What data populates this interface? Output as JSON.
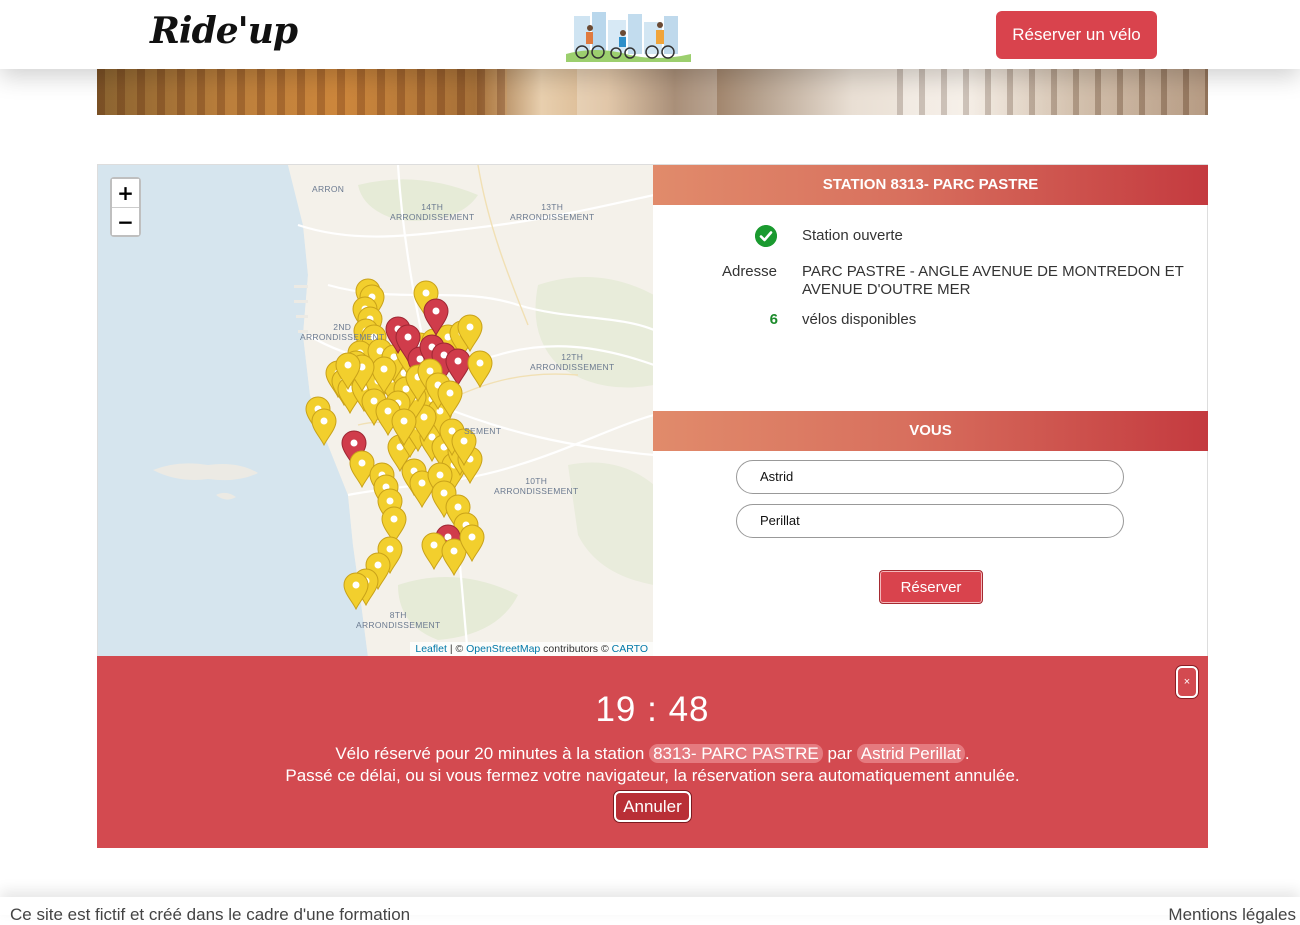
{
  "header": {
    "logo": "Ride'up",
    "reserve_button": "Réserver un vélo"
  },
  "map": {
    "zoom_in": "+",
    "zoom_out": "−",
    "labels": {
      "arron": "ARRON",
      "arr14": "14TH\nARRONDISSEMENT",
      "arr13": "13TH\nARRONDISSEMENT",
      "arr2": "2ND\nARRONDISSEMENT",
      "arr12": "12TH\nARRONDISSEMENT",
      "arr_partial": "SEMENT",
      "arr10": "10TH\nARRONDISSEMENT",
      "arr8": "8TH\nARRONDISSEMENT"
    },
    "attribution": {
      "leaflet": "Leaflet",
      "sep": " | © ",
      "osm": "OpenStreetMap",
      "contrib": " contributors © ",
      "carto": "CARTO"
    },
    "colors": {
      "marker_available": "#f2cf2d",
      "marker_empty": "#d03c4b"
    }
  },
  "station": {
    "title": "STATION 8313- PARC PASTRE",
    "status": "Station ouverte",
    "address_label": "Adresse",
    "address": "PARC PASTRE - ANGLE AVENUE DE MONTREDON ET AVENUE D'OUTRE MER",
    "bikes_count": "6",
    "bikes_label": "vélos disponibles",
    "icon": "check-circle-icon"
  },
  "you": {
    "title": "VOUS",
    "first_name": "Astrid",
    "last_name": "Perillat",
    "reserve_button": "Réserver"
  },
  "reservation": {
    "close": "×",
    "timer": "19 : 48",
    "msg_prefix": "Vélo réservé pour 20 minutes à la station ",
    "station": "8313- PARC PASTRE",
    "msg_mid": " par ",
    "person": "Astrid Perillat",
    "msg_end": ".",
    "notice": "Passé ce délai, ou si vous fermez votre navigateur, la réservation sera automatiquement annulée.",
    "cancel_button": "Annuler"
  },
  "footer": {
    "left": "Ce site est fictif et créé dans le cadre d'une formation",
    "right": "Mentions légales"
  },
  "colors": {
    "accent": "#d9434d",
    "banner_red": "#d34a50",
    "ok_green": "#1a9a2f"
  }
}
